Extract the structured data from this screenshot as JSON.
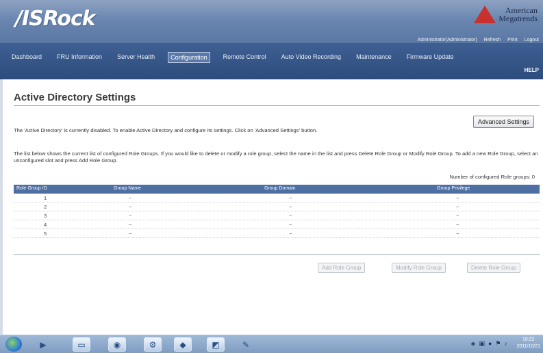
{
  "header": {
    "logo": "/ISRock",
    "vendor_line1": "American",
    "vendor_line2": "Megatrends",
    "top_links": [
      "Administrator(Administrator)",
      "Refresh",
      "Print",
      "Logout"
    ]
  },
  "nav": {
    "items": [
      "Dashboard",
      "FRU Information",
      "Server Health",
      "Configuration",
      "Remote Control",
      "Auto Video Recording",
      "Maintenance",
      "Firmware Update"
    ],
    "active_index": 3,
    "help": "HELP"
  },
  "page": {
    "title": "Active Directory Settings",
    "advanced_button": "Advanced Settings",
    "status_text": "The 'Active Directory' is currently disabled. To enable Active Directory and configure its settings. Click on 'Advanced Settings' button.",
    "info_text": "The list below shows the current list of configured Role Groups. If you would like to delete or modify a role group, select the name in the list and press Delete Role Group or Modify Role Group. To add a new Role Group, select an unconfigured slot and press Add Role Group.",
    "count_text": "Number of configured Role groups: 0"
  },
  "table": {
    "columns": [
      "Role Group ID",
      "Group Name",
      "Group Domain",
      "Group Privilege"
    ],
    "rows": [
      [
        "1",
        "~",
        "~",
        "~"
      ],
      [
        "2",
        "~",
        "~",
        "~"
      ],
      [
        "3",
        "~",
        "~",
        "~"
      ],
      [
        "4",
        "~",
        "~",
        "~"
      ],
      [
        "5",
        "~",
        "~",
        "~"
      ]
    ]
  },
  "actions": {
    "add": "Add Role Group",
    "modify": "Modify Role Group",
    "delete": "Delete Role Group"
  },
  "taskbar": {
    "clock_time": "10:22",
    "clock_date": "2011/10/21"
  }
}
